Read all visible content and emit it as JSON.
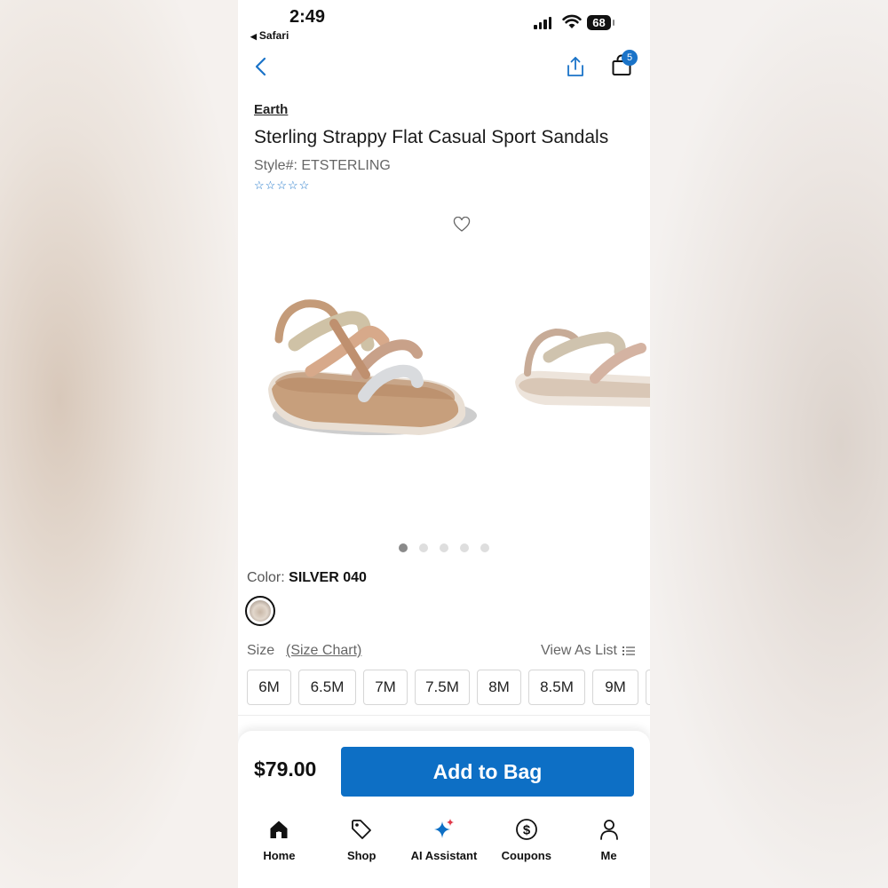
{
  "status_bar": {
    "time": "2:49",
    "back_app": "Safari",
    "battery": "68"
  },
  "nav": {
    "bag_count": "5"
  },
  "product": {
    "brand": "Earth",
    "title": "Sterling Strappy Flat Casual Sport Sandals",
    "style": "Style#: ETSTERLING",
    "rating_stars": 0
  },
  "gallery": {
    "image_count": 5,
    "current_index": 0
  },
  "color": {
    "label": "Color:",
    "value": "SILVER 040"
  },
  "size": {
    "label": "Size",
    "chart_link": "(Size Chart)",
    "view_as_list": "View As List",
    "options": [
      "6M",
      "6.5M",
      "7M",
      "7.5M",
      "8M",
      "8.5M",
      "9M"
    ]
  },
  "purchase": {
    "price": "$79.00",
    "add_to_bag": "Add to Bag"
  },
  "tabs": [
    {
      "label": "Home",
      "icon": "home-icon"
    },
    {
      "label": "Shop",
      "icon": "tag-icon"
    },
    {
      "label": "AI Assistant",
      "icon": "sparkle-icon"
    },
    {
      "label": "Coupons",
      "icon": "dollar-coin-icon"
    },
    {
      "label": "Me",
      "icon": "person-icon"
    }
  ],
  "colors": {
    "accent": "#0d6fc5",
    "badge": "#1a73c8"
  }
}
